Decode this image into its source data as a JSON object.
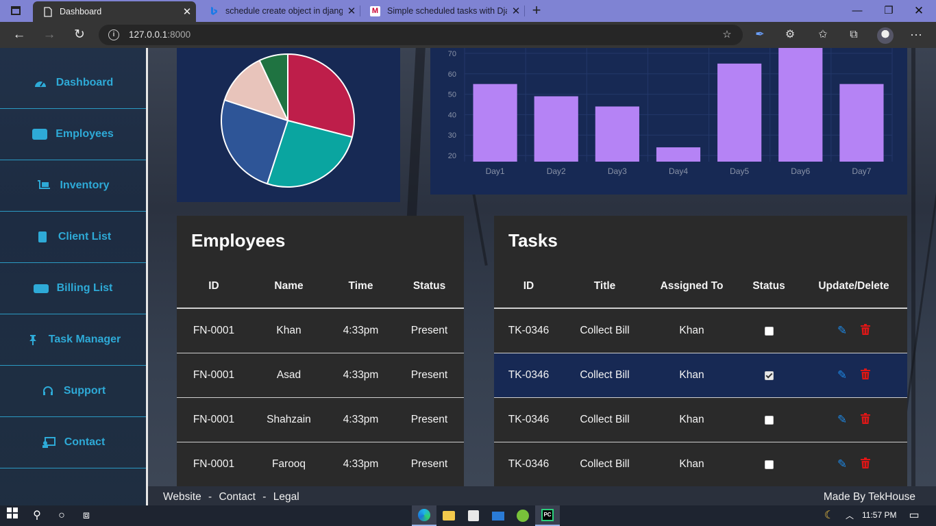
{
  "browser": {
    "tabs": [
      {
        "title": "Dashboard",
        "favicon": "page-icon",
        "active": true
      },
      {
        "title": "schedule create object in django",
        "favicon": "bing-icon",
        "active": false
      },
      {
        "title": "Simple scheduled tasks with Djan",
        "favicon": "medium-icon",
        "active": false
      }
    ],
    "url": "127.0.0.1",
    "url_port": ":8000"
  },
  "sidebar": {
    "items": [
      {
        "label": "Dashboard",
        "icon": "tachometer-icon"
      },
      {
        "label": "Employees",
        "icon": "id-card-icon"
      },
      {
        "label": "Inventory",
        "icon": "dolly-icon"
      },
      {
        "label": "Client List",
        "icon": "address-book-icon"
      },
      {
        "label": "Billing List",
        "icon": "money-bill-icon"
      },
      {
        "label": "Task Manager",
        "icon": "thumbtack-icon"
      },
      {
        "label": "Support",
        "icon": "headset-icon"
      },
      {
        "label": "Contact",
        "icon": "contact-icon"
      }
    ]
  },
  "chart_data": [
    {
      "type": "pie",
      "slices": [
        {
          "value": 29,
          "color": "#be1e4a"
        },
        {
          "value": 26,
          "color": "#0aa5a0"
        },
        {
          "value": 25,
          "color": "#2e5597"
        },
        {
          "value": 13,
          "color": "#e8c4bb"
        },
        {
          "value": 7,
          "color": "#1f7341"
        }
      ]
    },
    {
      "type": "bar",
      "categories": [
        "Day1",
        "Day2",
        "Day3",
        "Day4",
        "Day5",
        "Day6",
        "Day7"
      ],
      "values": [
        55,
        49,
        44,
        24,
        65,
        75,
        55
      ],
      "color": "#b583f5",
      "yticks": [
        20,
        30,
        40,
        50,
        60,
        70
      ],
      "ylim": [
        17,
        74
      ],
      "grid": true
    }
  ],
  "employees": {
    "title": "Employees",
    "header_color": "#107362",
    "columns": [
      "ID",
      "Name",
      "Time",
      "Status"
    ],
    "rows": [
      {
        "id": "FN-0001",
        "name": "Khan",
        "time": "4:33pm",
        "status": "Present"
      },
      {
        "id": "FN-0001",
        "name": "Asad",
        "time": "4:33pm",
        "status": "Present"
      },
      {
        "id": "FN-0001",
        "name": "Shahzain",
        "time": "4:33pm",
        "status": "Present"
      },
      {
        "id": "FN-0001",
        "name": "Farooq",
        "time": "4:33pm",
        "status": "Present"
      }
    ]
  },
  "tasks": {
    "title": "Tasks",
    "header_color": "#3a06b8",
    "columns": [
      "ID",
      "Title",
      "Assigned To",
      "Status",
      "Update/Delete"
    ],
    "rows": [
      {
        "id": "TK-0346",
        "title": "Collect Bill",
        "assigned": "Khan",
        "done": false
      },
      {
        "id": "TK-0346",
        "title": "Collect Bill",
        "assigned": "Khan",
        "done": true
      },
      {
        "id": "TK-0346",
        "title": "Collect Bill",
        "assigned": "Khan",
        "done": false
      },
      {
        "id": "TK-0346",
        "title": "Collect Bill",
        "assigned": "Khan",
        "done": false
      }
    ]
  },
  "footer": {
    "links": [
      "Website",
      "Contact",
      "Legal"
    ],
    "separator": "-",
    "credit": "Made By TekHouse"
  },
  "taskbar": {
    "time": "11:57 PM"
  }
}
